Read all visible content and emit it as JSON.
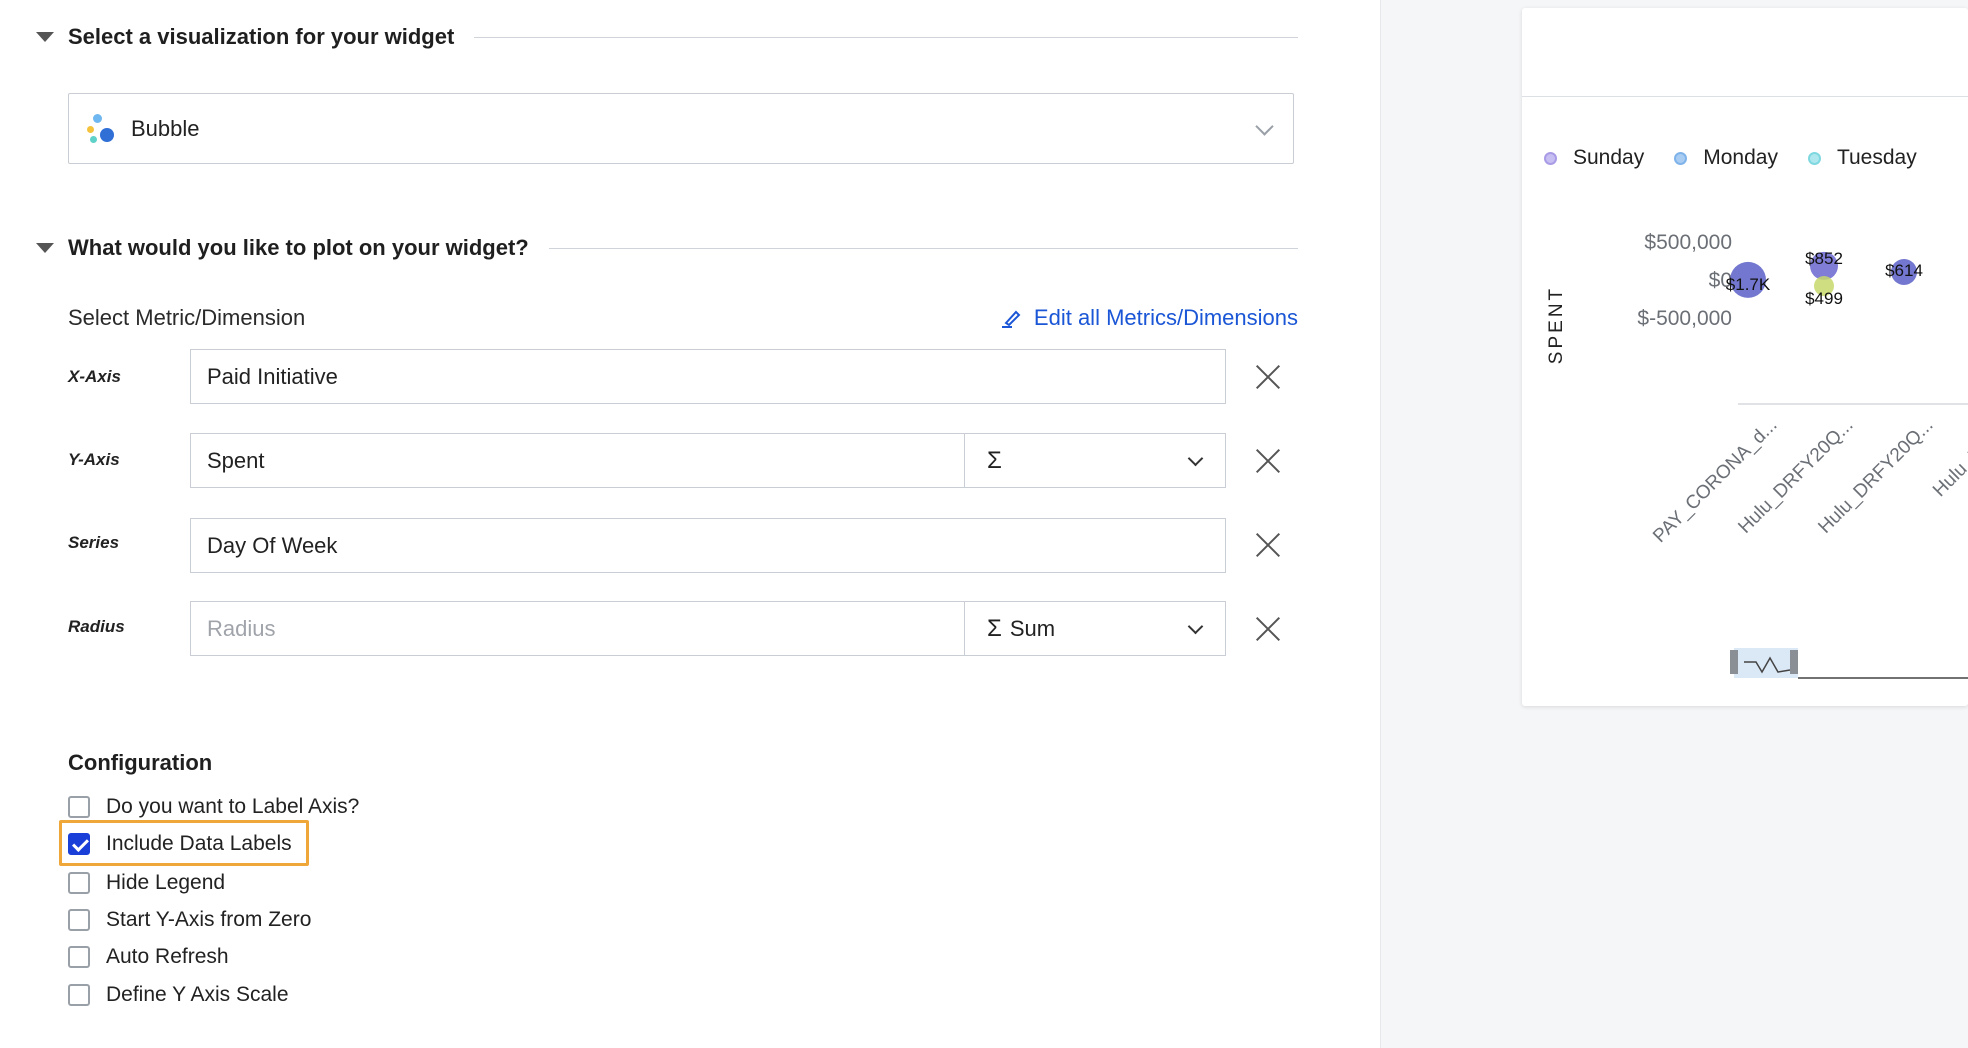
{
  "sections": {
    "visualization": {
      "title": "Select a visualization for your widget",
      "selected": "Bubble"
    },
    "plot": {
      "title": "What would you like to plot on your widget?",
      "metric_label": "Select Metric/Dimension",
      "edit_link": "Edit all Metrics/Dimensions",
      "rows": {
        "x_axis": {
          "label": "X-Axis",
          "value": "Paid Initiative"
        },
        "y_axis": {
          "label": "Y-Axis",
          "value": "Spent",
          "agg_symbol": "Σ",
          "agg_label": ""
        },
        "series": {
          "label": "Series",
          "value": "Day Of Week"
        },
        "radius": {
          "label": "Radius",
          "placeholder": "Radius",
          "agg_symbol": "Σ",
          "agg_label": "Sum"
        }
      }
    },
    "configuration": {
      "title": "Configuration",
      "options": [
        {
          "label": "Do you want to Label Axis?",
          "checked": false
        },
        {
          "label": "Include Data Labels",
          "checked": true
        },
        {
          "label": "Hide Legend",
          "checked": false
        },
        {
          "label": "Start Y-Axis from Zero",
          "checked": false
        },
        {
          "label": "Auto Refresh",
          "checked": false
        },
        {
          "label": "Define Y Axis Scale",
          "checked": false
        }
      ]
    }
  },
  "chart_data": {
    "type": "scatter",
    "ylabel": "SPENT",
    "yticks": [
      "$500,000",
      "$0",
      "$-500,000"
    ],
    "ylim": [
      -500000,
      500000
    ],
    "categories": [
      "PAY_CORONA_d...",
      "Hulu_DRFY20Q...",
      "Hulu_DRFY20Q...",
      "Hulu_DRFY"
    ],
    "legend": [
      {
        "name": "Sunday",
        "color": "#a99be6"
      },
      {
        "name": "Monday",
        "color": "#7fb3ea"
      },
      {
        "name": "Tuesday",
        "color": "#7fd8e0"
      }
    ],
    "points": [
      {
        "category": 0,
        "value": 1700,
        "label": "$1.7K",
        "color": "#5b5fc7"
      },
      {
        "category": 1,
        "value": 852,
        "label": "$852",
        "color": "#6a66cf"
      },
      {
        "category": 1,
        "value": 499,
        "label": "$499",
        "color": "#c7d86a"
      },
      {
        "category": 2,
        "value": 614,
        "label": "$614",
        "color": "#5b5fc7"
      }
    ],
    "legend_position": "top"
  }
}
